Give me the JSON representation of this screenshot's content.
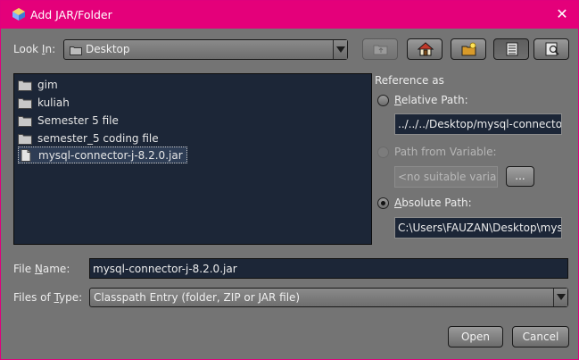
{
  "window": {
    "title": "Add JAR/Folder"
  },
  "look_in": {
    "label_pre": "Look ",
    "label_mn": "I",
    "label_post": "n:",
    "value": "Desktop"
  },
  "toolbar": {
    "icons": [
      "up-folder-icon",
      "home-icon",
      "new-folder-icon",
      "list-view-icon",
      "details-view-icon"
    ]
  },
  "files": [
    {
      "name": "gim",
      "type": "folder"
    },
    {
      "name": "kuliah",
      "type": "folder"
    },
    {
      "name": "Semester 5 file",
      "type": "folder"
    },
    {
      "name": "semester_5 coding file",
      "type": "folder"
    },
    {
      "name": "mysql-connector-j-8.2.0.jar",
      "type": "file",
      "selected": true
    }
  ],
  "reference": {
    "title": "Reference as",
    "relative": {
      "label_mn": "R",
      "label_rest": "elative Path:",
      "value": "../../../Desktop/mysql-connector-j-"
    },
    "variable": {
      "label": "Path from Variable:",
      "placeholder": "<no suitable variab",
      "browse_label": "..."
    },
    "absolute": {
      "label_mn": "A",
      "label_rest": "bsolute Path:",
      "value": "C:\\Users\\FAUZAN\\Desktop\\mysq"
    }
  },
  "file_name": {
    "label_pre": "File ",
    "label_mn": "N",
    "label_post": "ame:",
    "value": "mysql-connector-j-8.2.0.jar"
  },
  "file_type": {
    "label_pre": "Files of ",
    "label_mn": "T",
    "label_post": "ype:",
    "value": "Classpath Entry (folder, ZIP or JAR file)"
  },
  "buttons": {
    "open": "Open",
    "cancel": "Cancel"
  }
}
